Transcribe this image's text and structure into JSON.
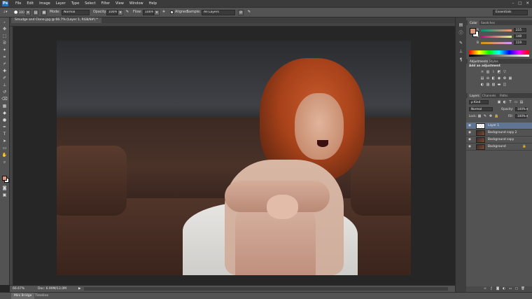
{
  "app": {
    "logo": "Ps",
    "menu": [
      "File",
      "Edit",
      "Image",
      "Layer",
      "Type",
      "Select",
      "Filter",
      "View",
      "Window",
      "Help"
    ],
    "window_controls": [
      "–",
      "□",
      "✕"
    ]
  },
  "options_bar": {
    "brush_size": "300",
    "mode_label": "Mode:",
    "mode_value": "Normal",
    "opacity_label": "Opacity:",
    "opacity_value": "100%",
    "flow_label": "Flow:",
    "flow_value": "100%",
    "aligned_label": "Aligned",
    "sample_label": "Sample:",
    "sample_value": "All Layers",
    "workspace": "Essentials"
  },
  "document": {
    "tab_title": "Smudge and Clone.jpg @ 66.7% (Layer 1, RGB/8#) *",
    "zoom": "66.67%",
    "doc_info": "Doc: 6.99M/13.0M"
  },
  "bottom_tabs": [
    "Mini Bridge",
    "Timeline"
  ],
  "panels": {
    "color_tabs": [
      "Color",
      "Swatches"
    ],
    "color": {
      "R": {
        "label": "R",
        "value": "215"
      },
      "G": {
        "label": "G",
        "value": "148"
      },
      "B": {
        "label": "B",
        "value": "119"
      },
      "foreground": "#d79477",
      "background": "#ffffff"
    },
    "adjustments_tabs": [
      "Adjustments",
      "Styles"
    ],
    "adjustments_title": "Add an adjustment",
    "layers_tabs": [
      "Layers",
      "Channels",
      "Paths"
    ],
    "layers": {
      "kind_value": "ρ Kind",
      "blend_mode": "Normal",
      "opacity_label": "Opacity:",
      "opacity_value": "100%",
      "lock_label": "Lock:",
      "fill_label": "Fill:",
      "fill_value": "100%",
      "items": [
        {
          "name": "Layer 1",
          "active": true
        },
        {
          "name": "Background copy 2",
          "active": false
        },
        {
          "name": "Background copy",
          "active": false
        },
        {
          "name": "Background",
          "active": false
        }
      ]
    }
  }
}
